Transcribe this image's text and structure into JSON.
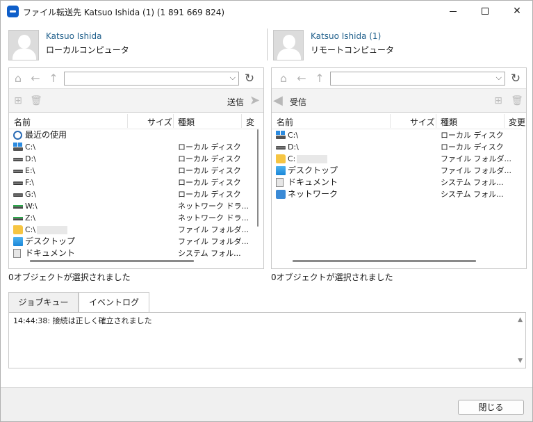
{
  "window": {
    "title": "ファイル転送先 Katsuo Ishida (1) (1 891 669 824)",
    "minimize_symbol": "",
    "maximize_symbol": "",
    "close_symbol": "✕"
  },
  "local": {
    "peer_name": "Katsuo Ishida",
    "peer_type": "ローカルコンピュータ",
    "path": "",
    "action_label": "送信",
    "columns": [
      "名前",
      "サイズ",
      "種類",
      "変"
    ],
    "rows": [
      {
        "name": "最近の使用",
        "type": "",
        "icon": "recent-icon"
      },
      {
        "name": "C:\\",
        "type": "ローカル ディスク",
        "icon": "system-drive-icon"
      },
      {
        "name": "D:\\",
        "type": "ローカル ディスク",
        "icon": "drive-icon"
      },
      {
        "name": "E:\\",
        "type": "ローカル ディスク",
        "icon": "drive-icon"
      },
      {
        "name": "F:\\",
        "type": "ローカル ディスク",
        "icon": "drive-icon"
      },
      {
        "name": "G:\\",
        "type": "ローカル ディスク",
        "icon": "drive-icon"
      },
      {
        "name": "W:\\",
        "type": "ネットワーク ドラ...",
        "icon": "network-drive-icon"
      },
      {
        "name": "Z:\\",
        "type": "ネットワーク ドラ...",
        "icon": "network-drive-icon"
      },
      {
        "name": "C:\\",
        "type": "ファイル フォルダ...",
        "icon": "folder-icon"
      },
      {
        "name": "デスクトップ",
        "type": "ファイル フォルダ...",
        "icon": "desktop-icon"
      },
      {
        "name": "ドキュメント",
        "type": "システム フォル...",
        "icon": "document-icon"
      }
    ],
    "status": "0オブジェクトが選択されました"
  },
  "remote": {
    "peer_name": "Katsuo Ishida (1)",
    "peer_type": "リモートコンピュータ",
    "path": "",
    "action_label": "受信",
    "columns": [
      "名前",
      "サイズ",
      "種類",
      "変更"
    ],
    "rows": [
      {
        "name": "C:\\",
        "type": "ローカル ディスク",
        "icon": "system-drive-icon"
      },
      {
        "name": "D:\\",
        "type": "ローカル ディスク",
        "icon": "drive-icon"
      },
      {
        "name": "C:",
        "type": "ファイル フォルダ...",
        "icon": "folder-icon"
      },
      {
        "name": "デスクトップ",
        "type": "ファイル フォルダ...",
        "icon": "desktop-icon"
      },
      {
        "name": "ドキュメント",
        "type": "システム フォル...",
        "icon": "document-icon"
      },
      {
        "name": "ネットワーク",
        "type": "システム フォル...",
        "icon": "network-icon"
      }
    ],
    "status": "0オブジェクトが選択されました"
  },
  "tabs": [
    {
      "label": "ジョブキュー",
      "active": false
    },
    {
      "label": "イベントログ",
      "active": true
    }
  ],
  "log": {
    "lines": [
      "14:44:38: 接続は正しく確立されました"
    ]
  },
  "footer": {
    "close_label": "閉じる"
  }
}
